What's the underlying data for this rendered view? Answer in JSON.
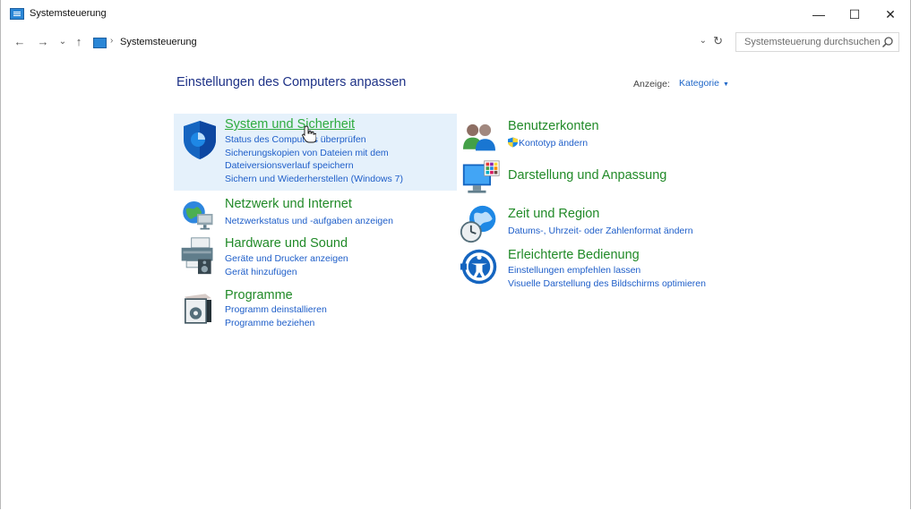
{
  "window": {
    "title": "Systemsteuerung",
    "controls": {
      "minimize": "—",
      "maximize": "☐",
      "close": "✕"
    }
  },
  "nav": {
    "back": "←",
    "forward": "→",
    "recent": "⌄",
    "up": "↑",
    "breadcrumb_separator": "›",
    "address": "Systemsteuerung",
    "dropdown": "⌄",
    "refresh": "↻",
    "search_placeholder": "Systemsteuerung durchsuchen"
  },
  "content": {
    "heading": "Einstellungen des Computers anpassen",
    "view_label": "Anzeige:",
    "view_value": "Kategorie",
    "view_caret": "▼"
  },
  "categories_left": [
    {
      "title": "System und Sicherheit",
      "icon": "shield-icon",
      "links": [
        "Status des Computers überprüfen",
        "Sicherungskopien von Dateien mit dem",
        "Dateiversionsverlauf speichern",
        "Sichern und Wiederherstellen (Windows 7)"
      ]
    },
    {
      "title": "Netzwerk und Internet",
      "icon": "network-globe-icon",
      "links": [
        "Netzwerkstatus und -aufgaben anzeigen"
      ]
    },
    {
      "title": "Hardware und Sound",
      "icon": "printer-speaker-icon",
      "links": [
        "Geräte und Drucker anzeigen",
        "Gerät hinzufügen"
      ]
    },
    {
      "title": "Programme",
      "icon": "programs-box-icon",
      "links": [
        "Programm deinstallieren",
        "Programme beziehen"
      ]
    }
  ],
  "categories_right": [
    {
      "title": "Benutzerkonten",
      "icon": "users-icon",
      "links": [
        "Kontotyp ändern"
      ]
    },
    {
      "title": "Darstellung und Anpassung",
      "icon": "monitor-palette-icon",
      "links": []
    },
    {
      "title": "Zeit und Region",
      "icon": "clock-globe-icon",
      "links": [
        "Datums-, Uhrzeit- oder Zahlenformat ändern"
      ]
    },
    {
      "title": "Erleichterte Bedienung",
      "icon": "accessibility-icon",
      "links": [
        "Einstellungen empfehlen lassen",
        "Visuelle Darstellung des Bildschirms optimieren"
      ]
    }
  ],
  "colors": {
    "category_title": "#218a28",
    "link": "#1e5ec9",
    "heading": "#1e3287",
    "hover_bg": "#e5f1fb"
  }
}
